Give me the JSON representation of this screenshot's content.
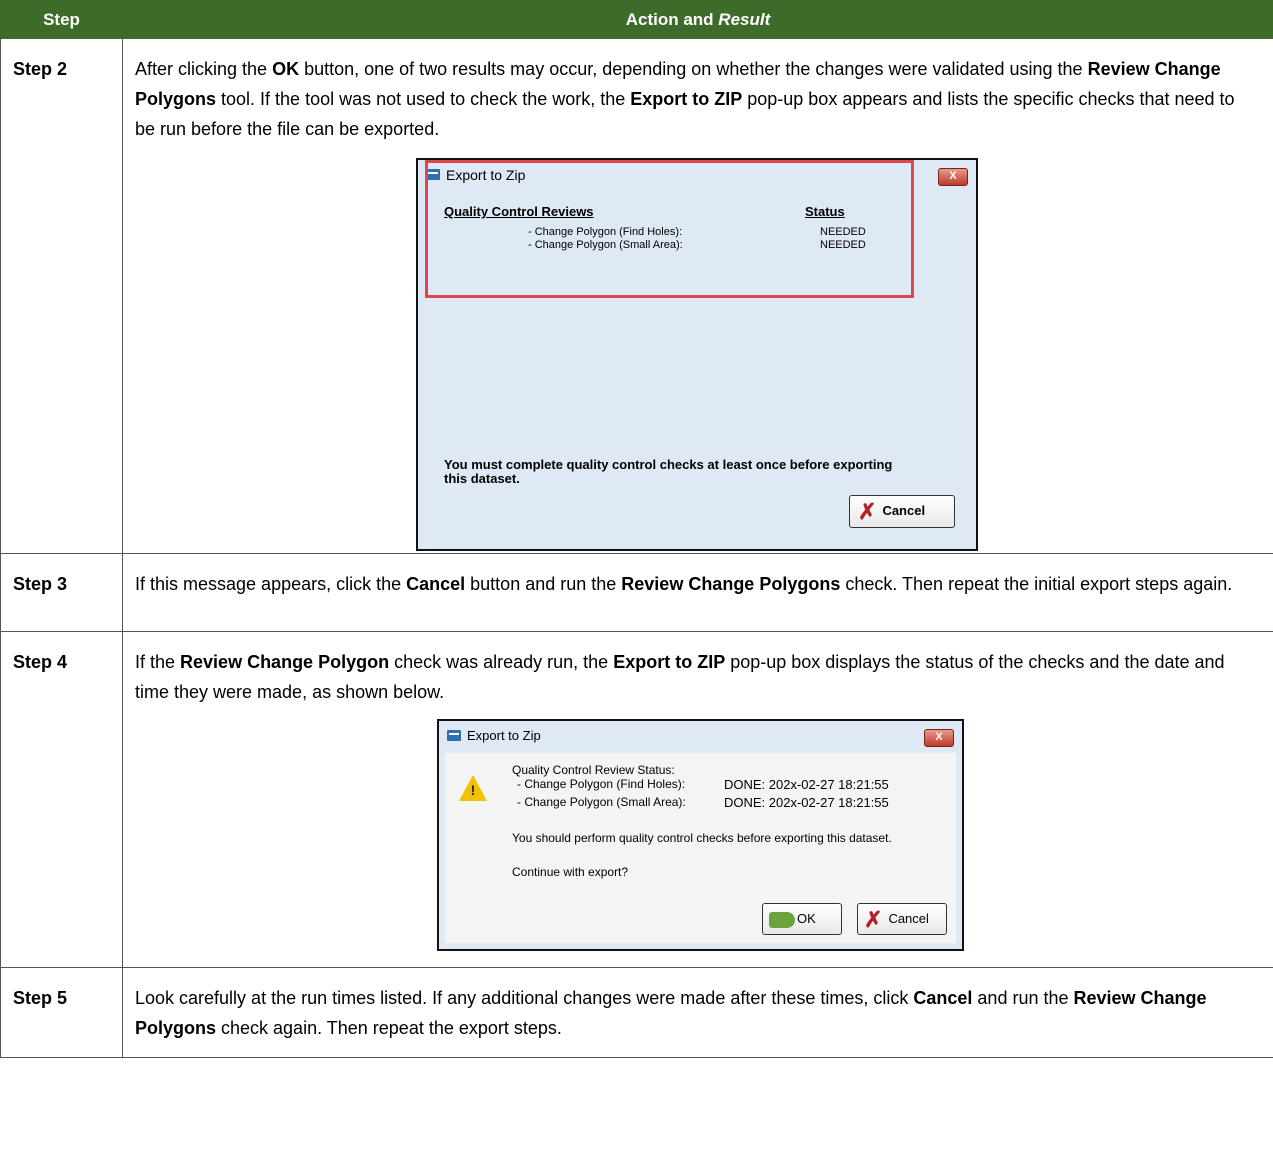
{
  "header": {
    "step": "Step",
    "action_pre": "Action and ",
    "action_em": "Result"
  },
  "steps": [
    {
      "label": "Step 2",
      "text": [
        {
          "t": "After clicking the "
        },
        {
          "b": "OK"
        },
        {
          "t": " button, one of two results may occur, depending on whether the changes were validated using the "
        },
        {
          "b": "Review Change Polygons"
        },
        {
          "t": " tool. If the tool was not used to check the work, the "
        },
        {
          "b": "Export to ZIP"
        },
        {
          "t": " pop-up box appears and lists the specific checks that need to be run before the file can be exported."
        }
      ]
    },
    {
      "label": "Step 3",
      "text": [
        {
          "t": "If this message appears, click the "
        },
        {
          "b": "Cancel"
        },
        {
          "t": " button and run the "
        },
        {
          "b": "Review Change Polygons"
        },
        {
          "t": " check. Then repeat the initial export steps again."
        }
      ]
    },
    {
      "label": "Step 4",
      "text": [
        {
          "t": "If the "
        },
        {
          "b": "Review Change Polygon"
        },
        {
          "t": " check was already run, the "
        },
        {
          "b": "Export to ZIP"
        },
        {
          "t": " pop-up box displays the status of the checks and the date and time they were made, as shown below."
        }
      ]
    },
    {
      "label": "Step 5",
      "text": [
        {
          "t": "Look carefully at the run times listed. If any additional changes were made after these times, click "
        },
        {
          "b": "Cancel"
        },
        {
          "t": " and run the "
        },
        {
          "b": "Review Change Polygons"
        },
        {
          "t": " check again. Then repeat the export steps."
        }
      ]
    }
  ],
  "dialog1": {
    "title": "Export to Zip",
    "logo": "GUPS",
    "col1": "Quality Control Reviews",
    "col2": "Status",
    "rows": [
      {
        "name": "- Change Polygon (Find Holes):",
        "status": "NEEDED"
      },
      {
        "name": "- Change Polygon (Small Area):",
        "status": "NEEDED"
      }
    ],
    "message": "You must complete quality control checks at least once before exporting this dataset.",
    "cancel": "Cancel",
    "close": "X"
  },
  "dialog2": {
    "title": "Export to Zip",
    "logo": "GUPS",
    "heading": "Quality Control Review Status:",
    "rows": [
      {
        "name": "- Change Polygon (Find Holes):",
        "status": "DONE: 202x-02-27 18:21:55"
      },
      {
        "name": "- Change Polygon (Small Area):",
        "status": "DONE: 202x-02-27 18:21:55"
      }
    ],
    "message": "You should perform quality control checks before exporting this dataset.",
    "question": "Continue with export?",
    "ok": "OK",
    "cancel": "Cancel",
    "close": "X"
  }
}
